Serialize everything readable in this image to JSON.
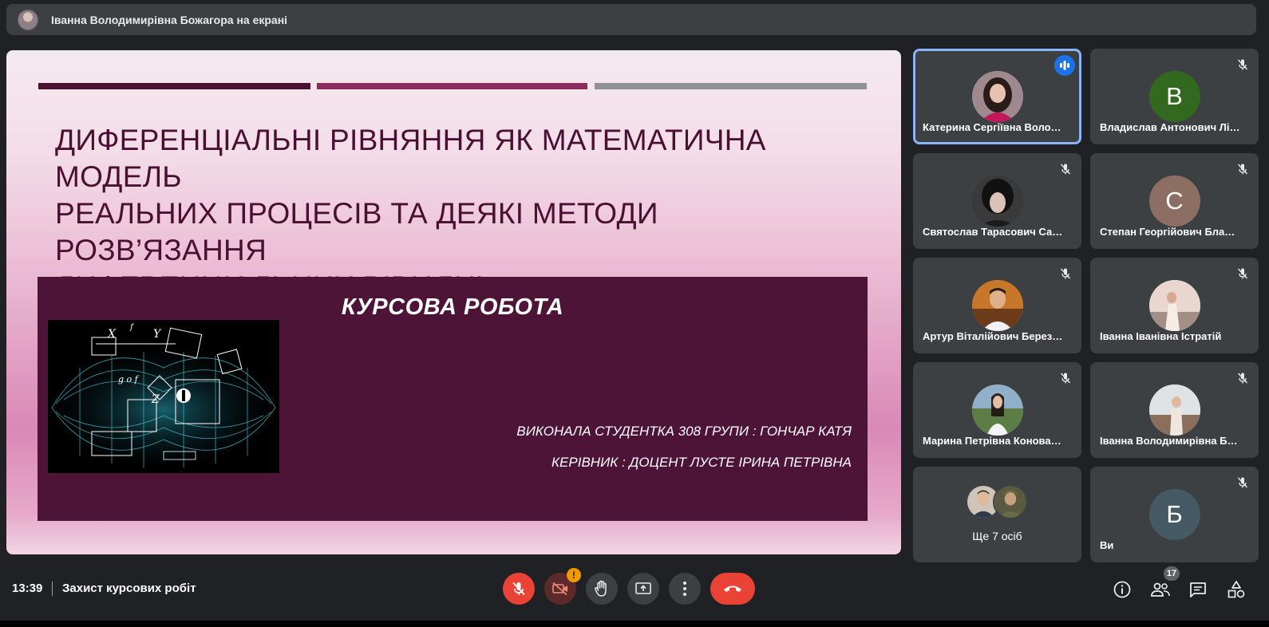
{
  "presenter": {
    "text": "Іванна Володимирівна Божагора на екрані"
  },
  "slide": {
    "title_lines": [
      "ДИФЕРЕНЦІАЛЬНІ РІВНЯННЯ ЯК МАТЕМАТИЧНА МОДЕЛЬ",
      "РЕАЛЬНИХ ПРОЦЕСІВ ТА ДЕЯКІ МЕТОДИ РОЗВ’ЯЗАННЯ",
      "ДИФЕРЕНЦІАЛЬНИХ РІВНЯНЬ"
    ],
    "panel_heading": "КУРСОВА РОБОТА",
    "credit_student": "ВИКОНАЛА СТУДЕНТКА 308 ГРУПИ : ГОНЧАР КАТЯ",
    "credit_supervisor": "КЕРІВНИК : ДОЦЕНТ ЛУСТЕ ІРИНА ПЕТРІВНА"
  },
  "participants": [
    {
      "name": "Катерина Сергіївна Воло…",
      "initial": "",
      "status": "speaking",
      "avatar_color": "#8a6e74"
    },
    {
      "name": "Владислав Антонович Лі…",
      "initial": "В",
      "status": "muted",
      "avatar_color": "#33691e"
    },
    {
      "name": "Святослав Тарасович Са…",
      "initial": "",
      "status": "muted",
      "avatar_color": "#2a2a2a"
    },
    {
      "name": "Степан Георгійович Бла…",
      "initial": "С",
      "status": "muted",
      "avatar_color": "#8d6e63"
    },
    {
      "name": "Артур Віталійович Берез…",
      "initial": "",
      "status": "muted",
      "avatar_color": "#b5651d"
    },
    {
      "name": "Іванна Іванівна Істратій",
      "initial": "",
      "status": "muted",
      "avatar_color": "#c9b3a6"
    },
    {
      "name": "Марина Петрівна Конова…",
      "initial": "",
      "status": "muted",
      "avatar_color": "#6d8a5a"
    },
    {
      "name": "Іванна Володимирівна Б…",
      "initial": "",
      "status": "muted",
      "avatar_color": "#b8a89a"
    }
  ],
  "more_tile": {
    "label": "Ще 7 осіб"
  },
  "self_tile": {
    "name": "Ви",
    "initial": "Б",
    "status": "muted",
    "avatar_color": "#455a64"
  },
  "bottom": {
    "clock": "13:39",
    "meeting_title": "Захист курсових робіт",
    "camera_warning": "!",
    "people_count": "17"
  },
  "colors": {
    "accent": "#8ab4f8",
    "end_call": "#ea4335",
    "warning": "#f29900",
    "slide_dark": "#4e1438"
  }
}
